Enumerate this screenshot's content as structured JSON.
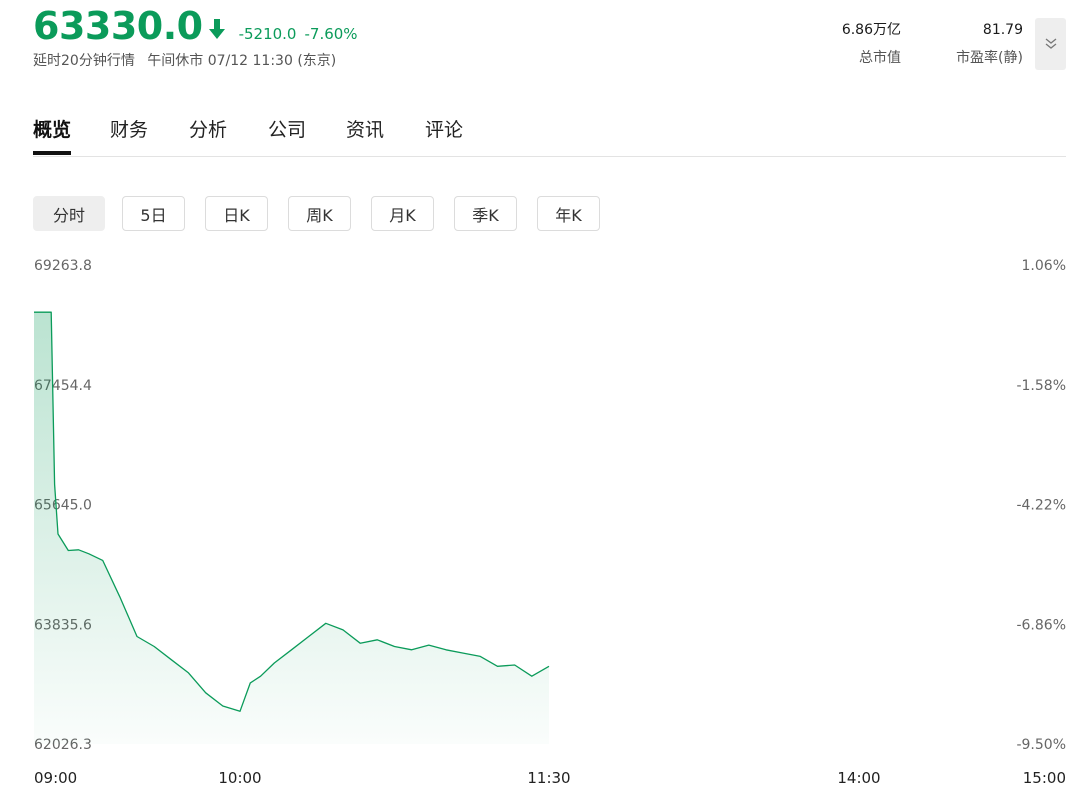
{
  "header": {
    "price": "63330.0",
    "change_abs": "-5210.0",
    "change_pct": "-7.60%",
    "delay_note": "延时20分钟行情",
    "status": "午间休市 07/12 11:30 (东京)",
    "market_cap_value": "6.86万亿",
    "market_cap_label": "总市值",
    "pe_value": "81.79",
    "pe_label": "市盈率(静)",
    "accent_down": "#0b9b5a"
  },
  "tabs": [
    "概览",
    "财务",
    "分析",
    "公司",
    "资讯",
    "评论"
  ],
  "periods": [
    "分时",
    "5日",
    "日K",
    "周K",
    "月K",
    "季K",
    "年K"
  ],
  "chart_data": {
    "type": "area",
    "y_left_labels": [
      "69263.8",
      "67454.4",
      "65645.0",
      "63835.6",
      "62026.3"
    ],
    "y_right_labels": [
      "1.06%",
      "-1.58%",
      "-4.22%",
      "-6.86%",
      "-9.50%"
    ],
    "x_labels": [
      "09:00",
      "10:00",
      "11:30",
      "14:00",
      "15:00"
    ],
    "ylim": [
      62026.3,
      69263.8
    ],
    "series": [
      {
        "x": [
          "09:00",
          "09:05",
          "09:06",
          "09:07",
          "09:10",
          "09:13",
          "09:16",
          "09:20",
          "09:25",
          "09:30",
          "09:35",
          "09:40",
          "09:45",
          "09:50",
          "09:55",
          "10:00",
          "10:03",
          "10:06",
          "10:10",
          "10:15",
          "10:20",
          "10:25",
          "10:30",
          "10:35",
          "10:40",
          "10:45",
          "10:50",
          "10:55",
          "11:00",
          "11:05",
          "11:10",
          "11:15",
          "11:20",
          "11:25",
          "11:30"
        ],
        "values": [
          68550,
          68550,
          65950,
          65200,
          64950,
          64960,
          64900,
          64800,
          64250,
          63650,
          63500,
          63300,
          63100,
          62800,
          62600,
          62520,
          62950,
          63050,
          63250,
          63450,
          63650,
          63850,
          63750,
          63550,
          63600,
          63500,
          63450,
          63520,
          63450,
          63400,
          63350,
          63200,
          63220,
          63050,
          63200
        ]
      }
    ],
    "line_color": "#0b9b5a",
    "grid": false
  }
}
